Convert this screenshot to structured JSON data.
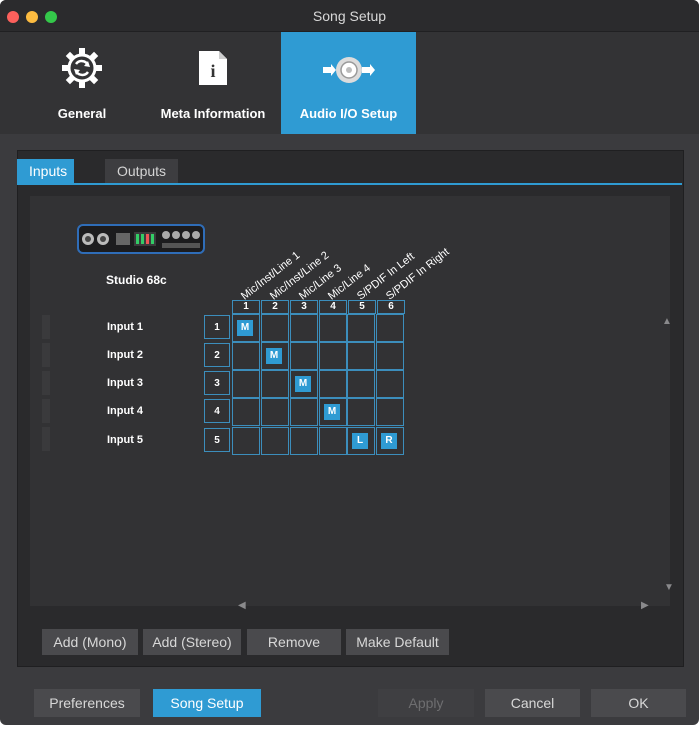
{
  "window": {
    "title": "Song Setup"
  },
  "toolbar": {
    "general": "General",
    "meta": "Meta Information",
    "audio": "Audio I/O Setup"
  },
  "tabs": {
    "inputs": "Inputs",
    "outputs": "Outputs"
  },
  "device": {
    "name": "Studio 68c"
  },
  "columns": [
    {
      "label": "Mic/Inst/Line 1",
      "num": "1"
    },
    {
      "label": "Mic/Inst/Line 2",
      "num": "2"
    },
    {
      "label": "Mic/Line 3",
      "num": "3"
    },
    {
      "label": "Mic/Line 4",
      "num": "4"
    },
    {
      "label": "S/PDIF In Left",
      "num": "5"
    },
    {
      "label": "S/PDIF In Right",
      "num": "6"
    }
  ],
  "rows": [
    {
      "label": "Input 1",
      "num": "1"
    },
    {
      "label": "Input 2",
      "num": "2"
    },
    {
      "label": "Input 3",
      "num": "3"
    },
    {
      "label": "Input 4",
      "num": "4"
    },
    {
      "label": "Input 5",
      "num": "5"
    }
  ],
  "assignments": [
    {
      "row": 0,
      "col": 0,
      "mark": "M"
    },
    {
      "row": 1,
      "col": 1,
      "mark": "M"
    },
    {
      "row": 2,
      "col": 2,
      "mark": "M"
    },
    {
      "row": 3,
      "col": 3,
      "mark": "M"
    },
    {
      "row": 4,
      "col": 4,
      "mark": "L"
    },
    {
      "row": 4,
      "col": 5,
      "mark": "R"
    }
  ],
  "actions": {
    "add_mono": "Add (Mono)",
    "add_stereo": "Add (Stereo)",
    "remove": "Remove",
    "make_default": "Make Default"
  },
  "footer": {
    "preferences": "Preferences",
    "song_setup": "Song Setup",
    "apply": "Apply",
    "cancel": "Cancel",
    "ok": "OK"
  }
}
